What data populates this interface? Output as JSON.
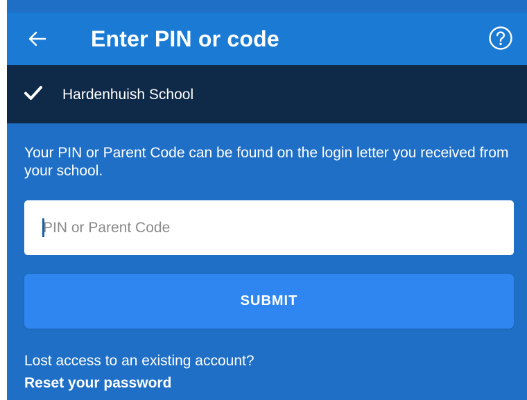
{
  "app_bar": {
    "title": "Enter PIN or code",
    "back_icon": "arrow-left-icon",
    "help_icon": "question-circle-icon",
    "color": "#1a7ad4"
  },
  "school": {
    "name": "Hardenhuish School",
    "check_icon": "checkmark-icon",
    "color": "#0e2a48"
  },
  "form": {
    "info_text": "Your PIN or Parent Code can be found on the login letter you received from your school.",
    "pin_placeholder": "PIN or Parent Code",
    "pin_value": "",
    "submit_label": "SUBMIT",
    "submit_color": "#2f86f0",
    "background_color": "#1f6fc6"
  },
  "footer": {
    "lost_text": "Lost access to an existing account?",
    "reset_link": "Reset your password"
  }
}
